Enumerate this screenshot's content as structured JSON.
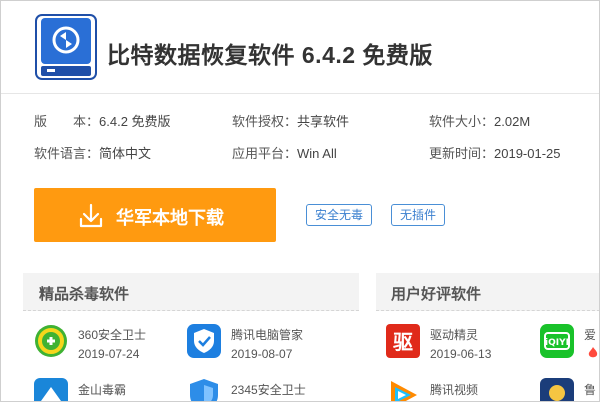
{
  "app": {
    "title": "比特数据恢复软件 6.4.2 免费版"
  },
  "info": {
    "version_key": "版　　本：",
    "version_val": "6.4.2 免费版",
    "license_key": "软件授权：",
    "license_val": "共享软件",
    "size_key": "软件大小：",
    "size_val": "2.02M",
    "lang_key": "软件语言：",
    "lang_val": "简体中文",
    "platform_key": "应用平台：",
    "platform_val": "Win All",
    "updated_key": "更新时间：",
    "updated_val": "2019-01-25"
  },
  "download": {
    "label": "华军本地下载",
    "icon": "download-icon",
    "color": "#ff9a10"
  },
  "tags": [
    "安全无毒",
    "无插件"
  ],
  "sections": {
    "left_title": "精品杀毒软件",
    "right_title": "用户好评软件"
  },
  "items": [
    {
      "name": "360安全卫士",
      "date": "2019-07-24",
      "icon": "360-security-icon"
    },
    {
      "name": "腾讯电脑管家",
      "date": "2019-08-07",
      "icon": "tencent-pc-manager-icon"
    },
    {
      "name": "驱动精灵",
      "date": "2019-06-13",
      "icon": "driver-genius-icon"
    },
    {
      "name": "爱",
      "date": "",
      "icon": "iqiyi-icon"
    },
    {
      "name": "金山毒霸",
      "date": "",
      "icon": "kingsoft-antivirus-icon"
    },
    {
      "name": "2345安全卫士",
      "date": "",
      "icon": "2345-security-icon"
    },
    {
      "name": "腾讯视频",
      "date": "",
      "icon": "tencent-video-icon"
    },
    {
      "name": "鲁",
      "date": "",
      "icon": "ludashi-icon"
    }
  ]
}
